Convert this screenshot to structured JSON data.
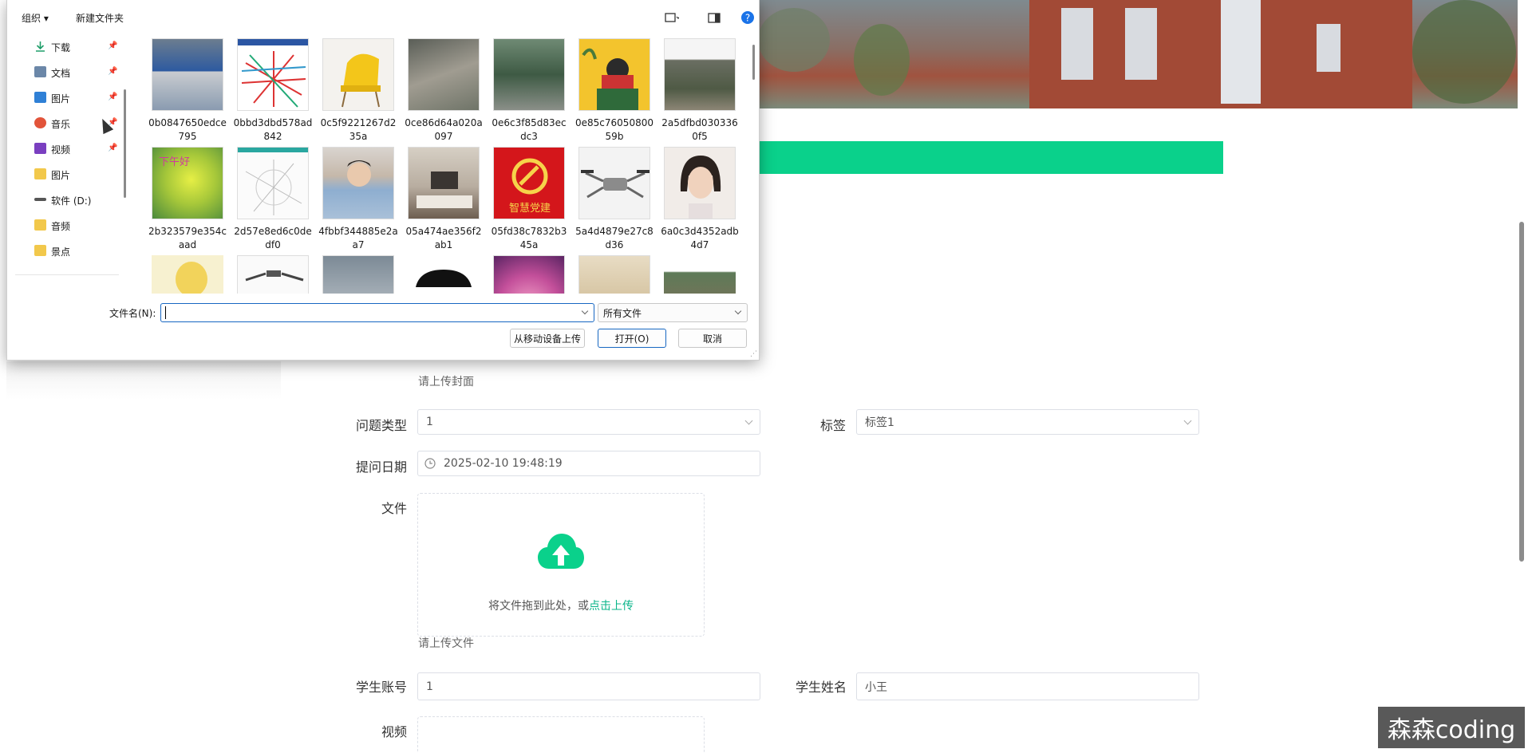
{
  "background_page": {
    "hints": {
      "cover": "请上传封面",
      "file": "请上传文件"
    },
    "fields": {
      "question_type": {
        "label": "问题类型",
        "value": "1"
      },
      "tag": {
        "label": "标签",
        "value": "标签1"
      },
      "ask_date": {
        "label": "提问日期",
        "value": "2025-02-10 19:48:19"
      },
      "file": {
        "label": "文件"
      },
      "student_account": {
        "label": "学生账号",
        "value": "1"
      },
      "student_name": {
        "label": "学生姓名",
        "value": "小王"
      },
      "video": {
        "label": "视频"
      }
    },
    "upload": {
      "text": "将文件拖到此处，或",
      "link": "点击上传"
    },
    "accent_color": "#0ad18b",
    "watermark": "森森coding"
  },
  "dialog": {
    "toolbar": {
      "organize": "组织",
      "new_folder": "新建文件夹"
    },
    "nav": [
      {
        "label": "下载",
        "icon": "download-icon",
        "pinned": true
      },
      {
        "label": "文档",
        "icon": "document-icon",
        "pinned": true
      },
      {
        "label": "图片",
        "icon": "pictures-icon",
        "pinned": true
      },
      {
        "label": "音乐",
        "icon": "music-icon",
        "pinned": true
      },
      {
        "label": "视频",
        "icon": "video-icon",
        "pinned": true
      },
      {
        "label": "图片",
        "icon": "folder-icon",
        "pinned": false
      },
      {
        "label": "软件 (D:)",
        "icon": "drive-icon",
        "pinned": false
      },
      {
        "label": "音频",
        "icon": "folder-icon",
        "pinned": false
      },
      {
        "label": "景点",
        "icon": "folder-icon",
        "pinned": false
      }
    ],
    "files": [
      "0b0847650edce795",
      "0bbd3dbd578ad842",
      "0c5f9221267d235a",
      "0ce86d64a020a097",
      "0e6c3f85d83ecdc3",
      "0e85c7605080059b",
      "2a5dfbd0303360f5",
      "2b323579e354caad",
      "2d57e8ed6c0dedf0",
      "4fbbf344885e2aa7",
      "05a474ae356f2ab1",
      "05fd38c7832b345a",
      "5a4d4879e27c8d36",
      "6a0c3d4352adb4d7",
      "",
      "",
      "",
      "",
      "",
      "",
      ""
    ],
    "thumb_text": {
      "party": "智慧党建",
      "flower": "下午好"
    },
    "filename_label": "文件名(N):",
    "filename_value": "",
    "filetype": "所有文件",
    "buttons": {
      "mobile_upload": "从移动设备上传",
      "open": "打开(O)",
      "cancel": "取消"
    }
  }
}
